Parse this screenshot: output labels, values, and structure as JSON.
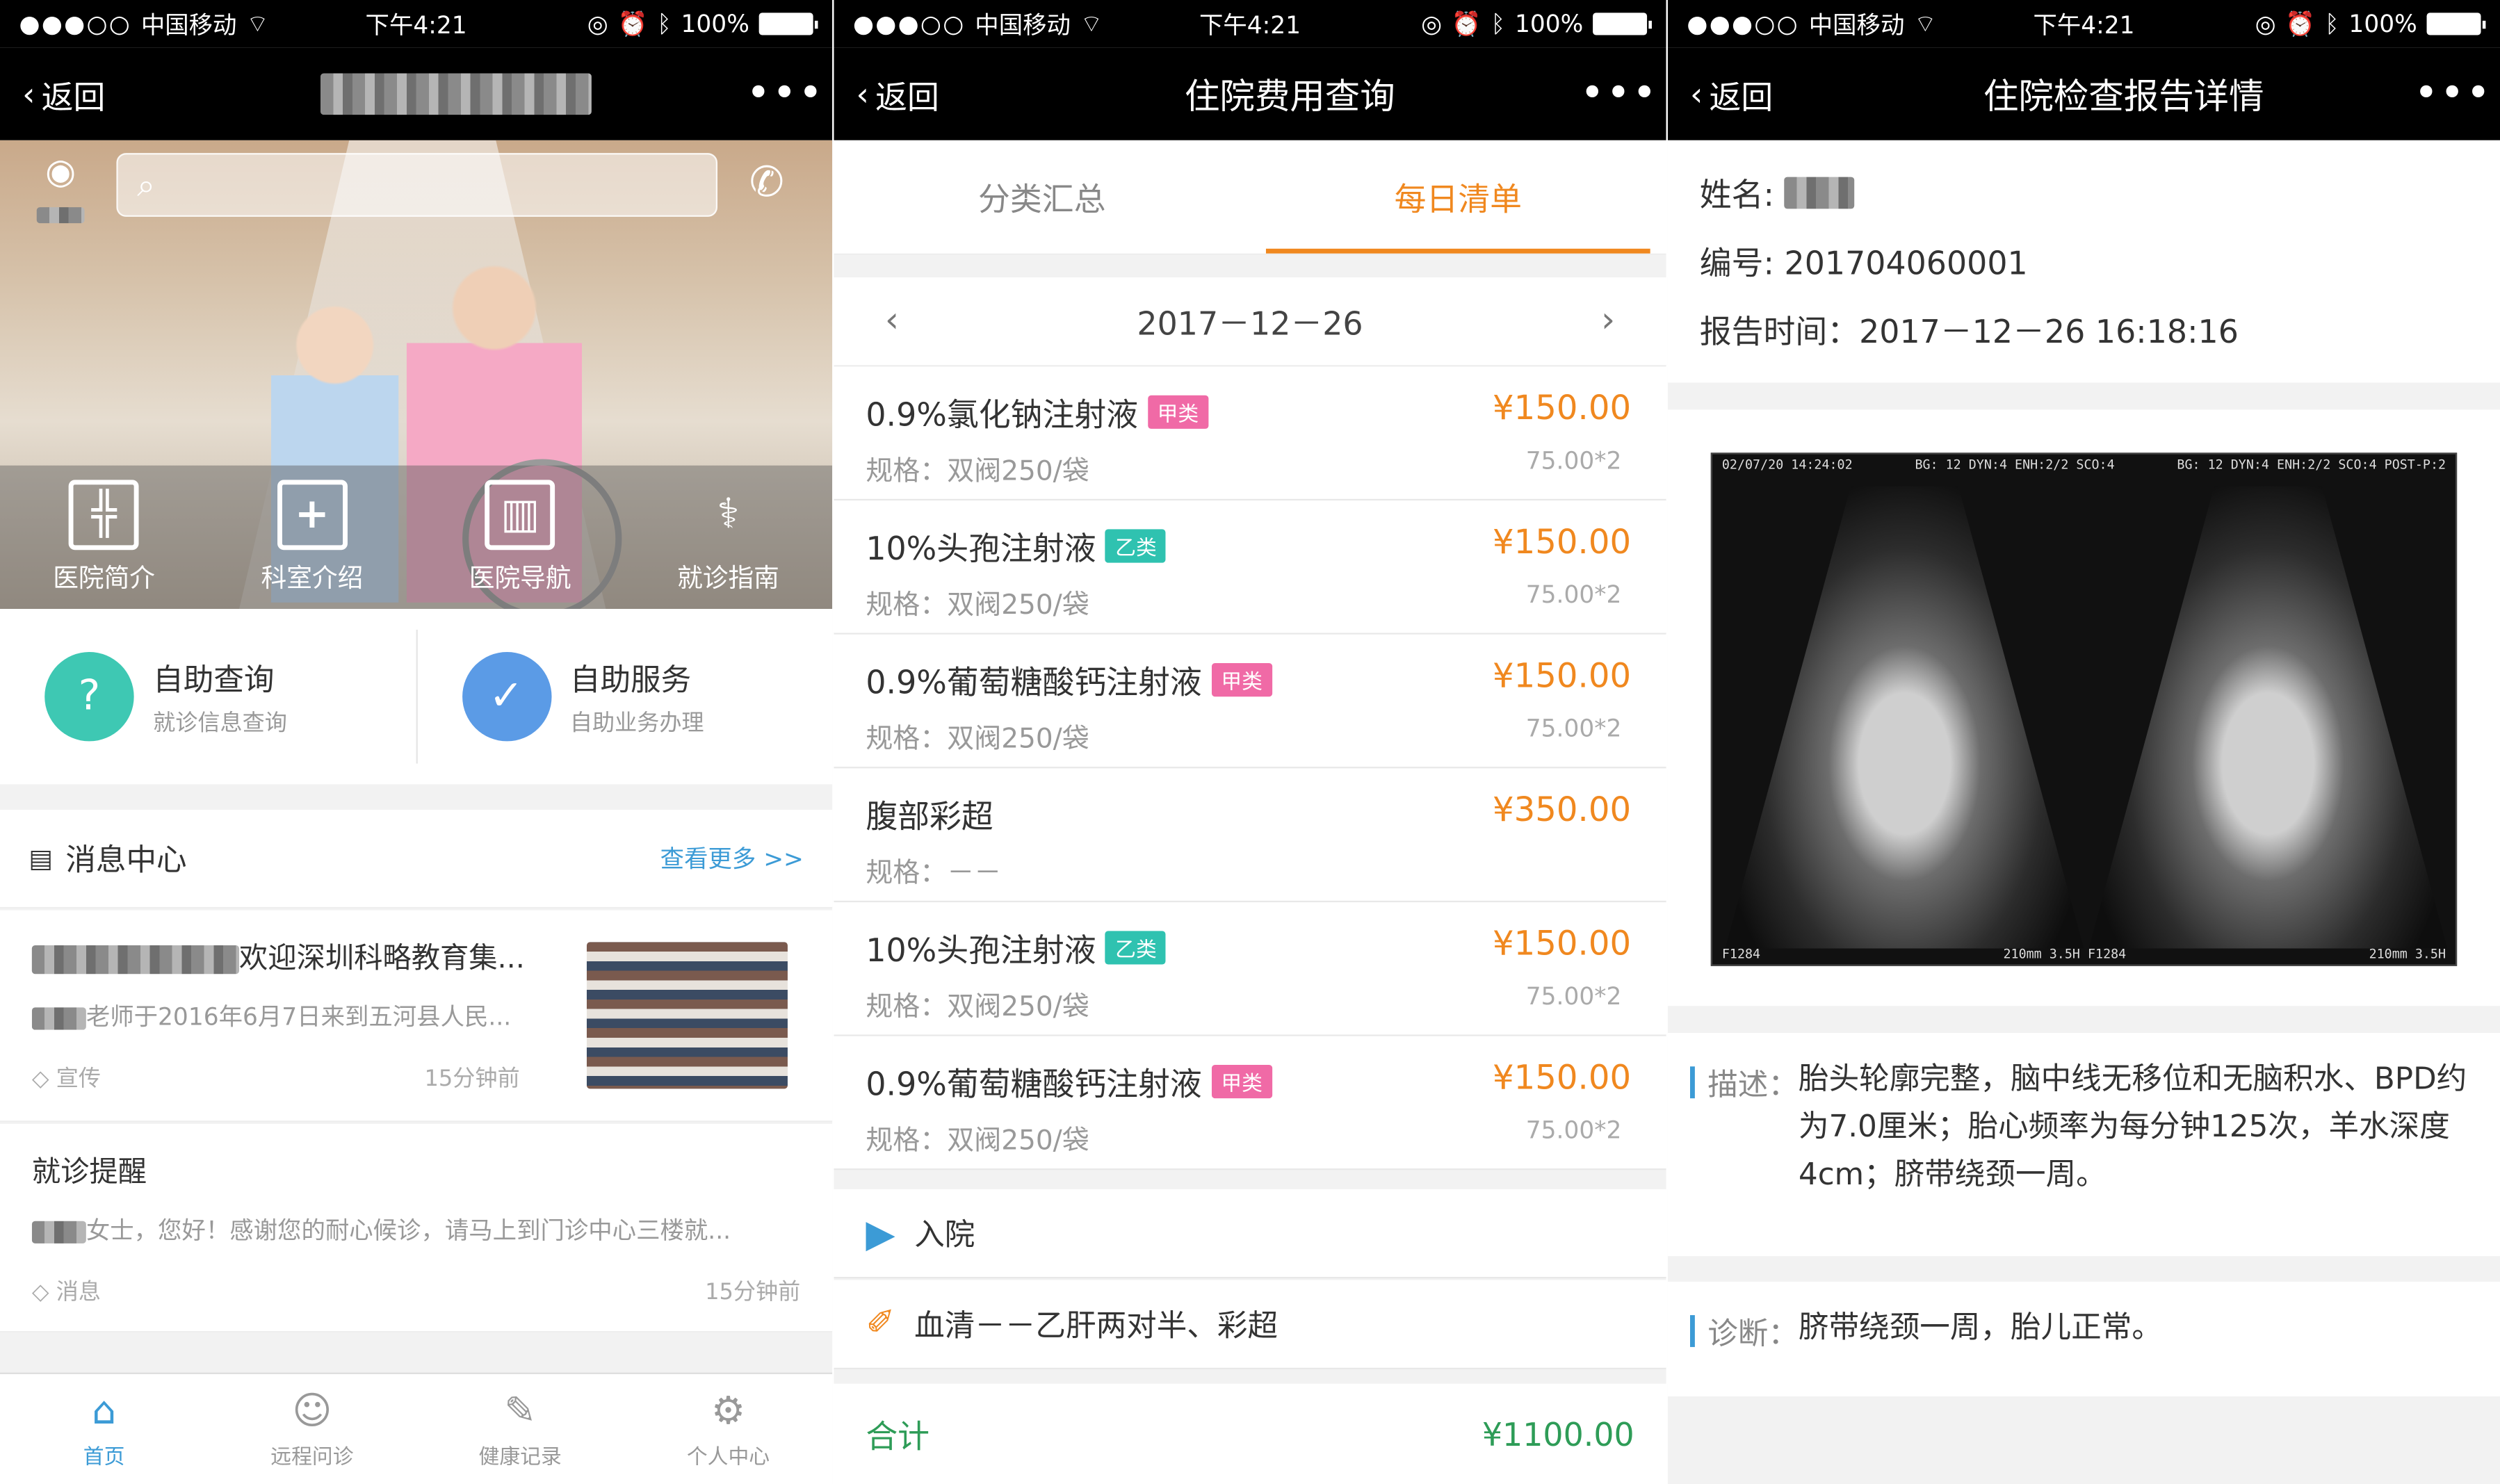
{
  "status": {
    "carrier": "中国移动",
    "time": "下午4:21",
    "battery": "100%"
  },
  "common": {
    "back": "返回",
    "more": "•••"
  },
  "p1": {
    "hero_items": [
      {
        "label": "医院简介",
        "icon": "hospital-icon"
      },
      {
        "label": "科室介绍",
        "icon": "department-icon"
      },
      {
        "label": "医院导航",
        "icon": "map-icon"
      },
      {
        "label": "就诊指南",
        "icon": "stethoscope-icon"
      }
    ],
    "quick": [
      {
        "title": "自助查询",
        "sub": "就诊信息查询",
        "color": "#3ec8b3"
      },
      {
        "title": "自助服务",
        "sub": "自助业务办理",
        "color": "#5b9be6"
      }
    ],
    "msg_center": {
      "title": "消息中心",
      "more": "查看更多 >>"
    },
    "messages": [
      {
        "title": "欢迎深圳科略教育集...",
        "body": "老师于2016年6月7日来到五河县人民...",
        "tag": "宣传",
        "time": "15分钟前"
      },
      {
        "title": "就诊提醒",
        "body": "女士，您好！感谢您的耐心候诊，请马上到门诊中心三楼就...",
        "tag": "消息",
        "time": "15分钟前"
      }
    ],
    "tabs": [
      {
        "label": "首页",
        "icon": "home-icon"
      },
      {
        "label": "远程问诊",
        "icon": "doctor-icon"
      },
      {
        "label": "健康记录",
        "icon": "record-icon"
      },
      {
        "label": "个人中心",
        "icon": "settings-icon"
      }
    ]
  },
  "p2": {
    "title": "住院费用查询",
    "seg": [
      "分类汇总",
      "每日清单"
    ],
    "date": "2017－12－26",
    "fees": [
      {
        "name": "0.9%氯化钠注射液",
        "tag": "甲类",
        "tag_color": "#f06aa6",
        "spec": "规格：双阀250/袋",
        "price": "¥150.00",
        "unit": "75.00*2"
      },
      {
        "name": "10%头孢注射液",
        "tag": "乙类",
        "tag_color": "#2fc2b0",
        "spec": "规格：双阀250/袋",
        "price": "¥150.00",
        "unit": "75.00*2"
      },
      {
        "name": "0.9%葡萄糖酸钙注射液",
        "tag": "甲类",
        "tag_color": "#f06aa6",
        "spec": "规格：双阀250/袋",
        "price": "¥150.00",
        "unit": "75.00*2"
      },
      {
        "name": "腹部彩超",
        "tag": "",
        "tag_color": "",
        "spec": "规格：－－",
        "price": "¥350.00",
        "unit": ""
      },
      {
        "name": "10%头孢注射液",
        "tag": "乙类",
        "tag_color": "#2fc2b0",
        "spec": "规格：双阀250/袋",
        "price": "¥150.00",
        "unit": "75.00*2"
      },
      {
        "name": "0.9%葡萄糖酸钙注射液",
        "tag": "甲类",
        "tag_color": "#f06aa6",
        "spec": "规格：双阀250/袋",
        "price": "¥150.00",
        "unit": "75.00*2"
      }
    ],
    "admit": "入院",
    "tests": "血清－－乙肝两对半、彩超",
    "total_label": "合计",
    "total": "¥1100.00"
  },
  "p3": {
    "title": "住院检查报告详情",
    "name_label": "姓名:",
    "id_line": "编号: 201704060001",
    "time_line": "报告时间：2017－12－26 16:18:16",
    "us_header_left": "02/07/20 14:24:02",
    "us_header_mid": "BG: 12 DYN:4 ENH:2/2 SCO:4",
    "us_header_right": "BG: 12 DYN:4 ENH:2/2 SCO:4 POST-P:2",
    "us_footer_left": "F1284",
    "us_footer_mid": "210mm 3.5H F1284",
    "us_footer_right": "210mm 3.5H",
    "desc_label": "描述：",
    "desc": "胎头轮廓完整，脑中线无移位和无脑积水、BPD约为7.0厘米；胎心频率为每分钟125次，羊水深度4cm；脐带绕颈一周。",
    "diag_label": "诊断：",
    "diag": "脐带绕颈一周，胎儿正常。"
  }
}
